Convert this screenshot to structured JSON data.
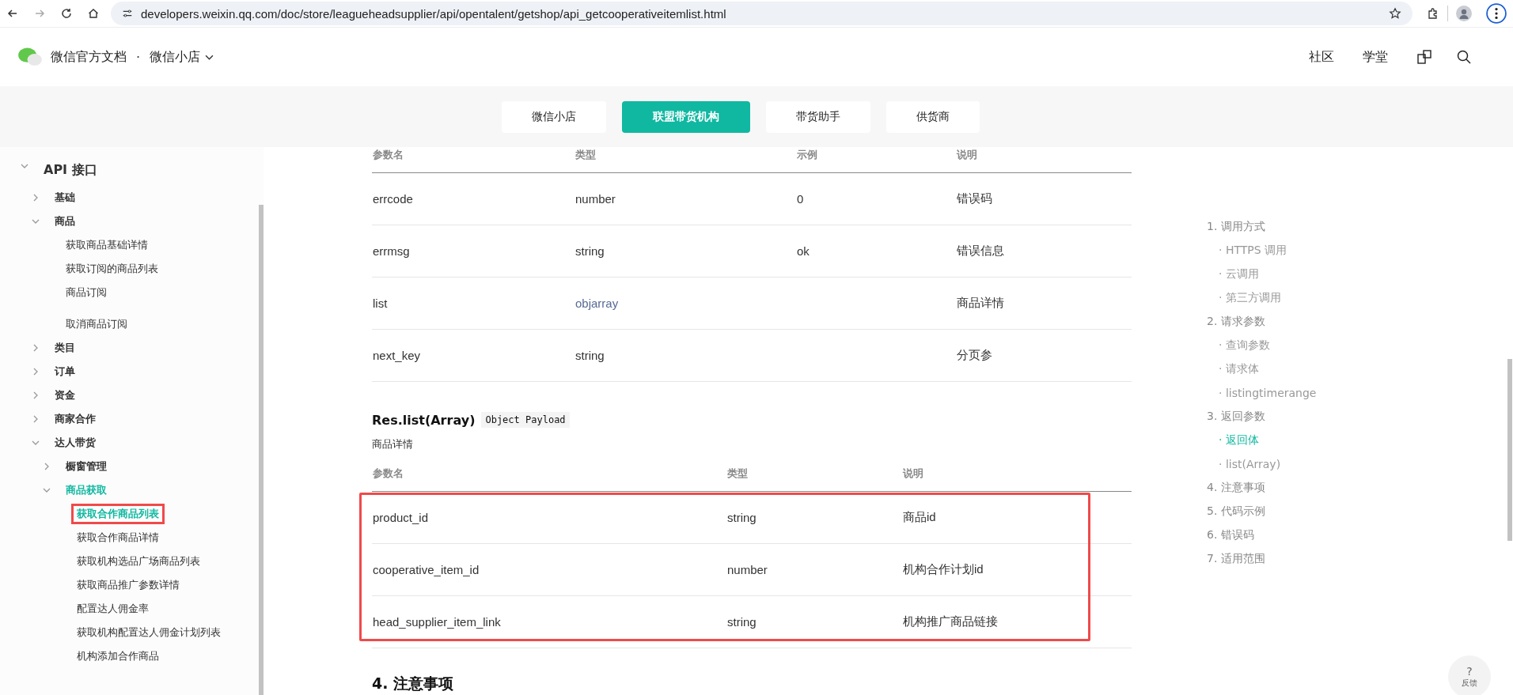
{
  "browser": {
    "url": "developers.weixin.qq.com/doc/store/leagueheadsupplier/api/opentalent/getshop/api_getcooperativeitemlist.html"
  },
  "header": {
    "site": "微信官方文档",
    "dot": "·",
    "product": "微信小店",
    "links": [
      "社区",
      "学堂"
    ]
  },
  "nav_tabs": [
    {
      "label": "微信小店",
      "selected": false
    },
    {
      "label": "联盟带货机构",
      "selected": true
    },
    {
      "label": "带货助手",
      "selected": false
    },
    {
      "label": "供货商",
      "selected": false
    }
  ],
  "sidebar": [
    {
      "label": "API 接口",
      "expanded": true,
      "selected": false,
      "children": [
        {
          "label": "基础",
          "expanded": false,
          "selected": false
        },
        {
          "label": "商品",
          "expanded": true,
          "selected": false,
          "children": [
            {
              "label": "获取商品基础详情",
              "selected": false,
              "annotated": false
            },
            {
              "label": "获取订阅的商品列表",
              "selected": false,
              "annotated": false
            },
            {
              "label": "商品订阅",
              "selected": false,
              "annotated": false
            },
            {
              "label": "取消商品订阅",
              "selected": false,
              "annotated": false
            }
          ]
        },
        {
          "label": "类目",
          "expanded": false,
          "selected": false
        },
        {
          "label": "订单",
          "expanded": false,
          "selected": false
        },
        {
          "label": "资金",
          "expanded": false,
          "selected": false
        },
        {
          "label": "商家合作",
          "expanded": false,
          "selected": false
        },
        {
          "label": "达人带货",
          "expanded": true,
          "selected": false,
          "children": [
            {
              "label": "橱窗管理",
              "expanded": false,
              "selected": false
            },
            {
              "label": "商品获取",
              "expanded": true,
              "selected": true,
              "children": [
                {
                  "label": "获取合作商品列表",
                  "selected": true,
                  "annotated": true
                },
                {
                  "label": "获取合作商品详情",
                  "selected": false,
                  "annotated": false
                },
                {
                  "label": "获取机构选品广场商品列表",
                  "selected": false,
                  "annotated": false
                },
                {
                  "label": "获取商品推广参数详情",
                  "selected": false,
                  "annotated": false
                },
                {
                  "label": "配置达人佣金率",
                  "selected": false,
                  "annotated": false
                },
                {
                  "label": "获取机构配置达人佣金计划列表",
                  "selected": false,
                  "annotated": false
                },
                {
                  "label": "机构添加合作商品",
                  "selected": false,
                  "annotated": false
                }
              ]
            }
          ]
        }
      ]
    }
  ],
  "content": {
    "table1": {
      "columns": [
        "参数名",
        "类型",
        "示例",
        "说明"
      ],
      "rows": [
        {
          "cells": [
            "errcode",
            "number",
            "0",
            "错误码"
          ],
          "link": false
        },
        {
          "cells": [
            "errmsg",
            "string",
            "ok",
            "错误信息"
          ],
          "link": false
        },
        {
          "cells": [
            "list",
            "objarray",
            "",
            "商品详情"
          ],
          "link": true
        },
        {
          "cells": [
            "next_key",
            "string",
            "",
            "分页参"
          ],
          "link": false
        }
      ]
    },
    "section_title": "Res.list(Array)",
    "section_tag": "Object Payload",
    "section_desc": "商品详情",
    "table2": {
      "columns": [
        "参数名",
        "类型",
        "说明"
      ],
      "annotated": true,
      "rows": [
        {
          "cells": [
            "product_id",
            "string",
            "商品id"
          ]
        },
        {
          "cells": [
            "cooperative_item_id",
            "number",
            "机构合作计划id"
          ]
        },
        {
          "cells": [
            "head_supplier_item_link",
            "string",
            "机构推广商品链接"
          ]
        }
      ]
    },
    "next_heading": "4. 注意事项"
  },
  "toc": [
    {
      "label": "1. 调用方式",
      "sub": false,
      "selected": false
    },
    {
      "label": "· HTTPS 调用",
      "sub": true,
      "selected": false
    },
    {
      "label": "· 云调用",
      "sub": true,
      "selected": false
    },
    {
      "label": "· 第三方调用",
      "sub": true,
      "selected": false
    },
    {
      "label": "2. 请求参数",
      "sub": false,
      "selected": false
    },
    {
      "label": "· 查询参数",
      "sub": true,
      "selected": false
    },
    {
      "label": "· 请求体",
      "sub": true,
      "selected": false
    },
    {
      "label": "· listingtimerange",
      "sub": true,
      "selected": false
    },
    {
      "label": "3. 返回参数",
      "sub": false,
      "selected": false
    },
    {
      "label": "· 返回体",
      "sub": true,
      "selected": true
    },
    {
      "label": "· list(Array)",
      "sub": true,
      "selected": false
    },
    {
      "label": "4. 注意事项",
      "sub": false,
      "selected": false
    },
    {
      "label": "5. 代码示例",
      "sub": false,
      "selected": false
    },
    {
      "label": "6. 错误码",
      "sub": false,
      "selected": false
    },
    {
      "label": "7. 适用范围",
      "sub": false,
      "selected": false
    }
  ],
  "feedback": {
    "mark": "?",
    "label": "反馈"
  }
}
